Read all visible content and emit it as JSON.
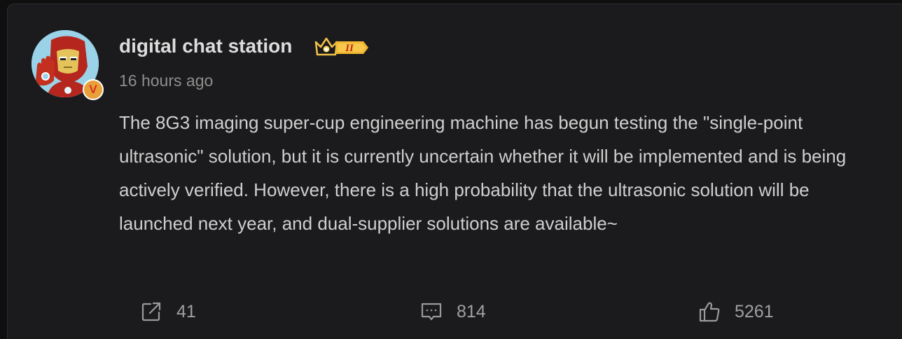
{
  "post": {
    "author": {
      "name": "digital chat station",
      "verified_mark": "V",
      "level_mark": "II"
    },
    "timestamp": "16 hours ago",
    "text": "The 8G3 imaging super-cup engineering machine has begun testing the \"single-point ultrasonic\" solution, but it is currently uncertain whether it will be implemented and is being actively verified. However, there is a high probability that the ultrasonic solution will be launched next year, and dual-supplier solutions are available~"
  },
  "actions": {
    "share": {
      "icon": "share-icon",
      "count": "41"
    },
    "comment": {
      "icon": "comment-icon",
      "count": "814"
    },
    "like": {
      "icon": "thumbs-up-icon",
      "count": "5261"
    }
  },
  "colors": {
    "background": "#1b1b1d",
    "text": "#cfcfcf",
    "muted": "#8e8e8e",
    "badge_gold": "#e8a13a",
    "badge_red": "#d6321c"
  }
}
